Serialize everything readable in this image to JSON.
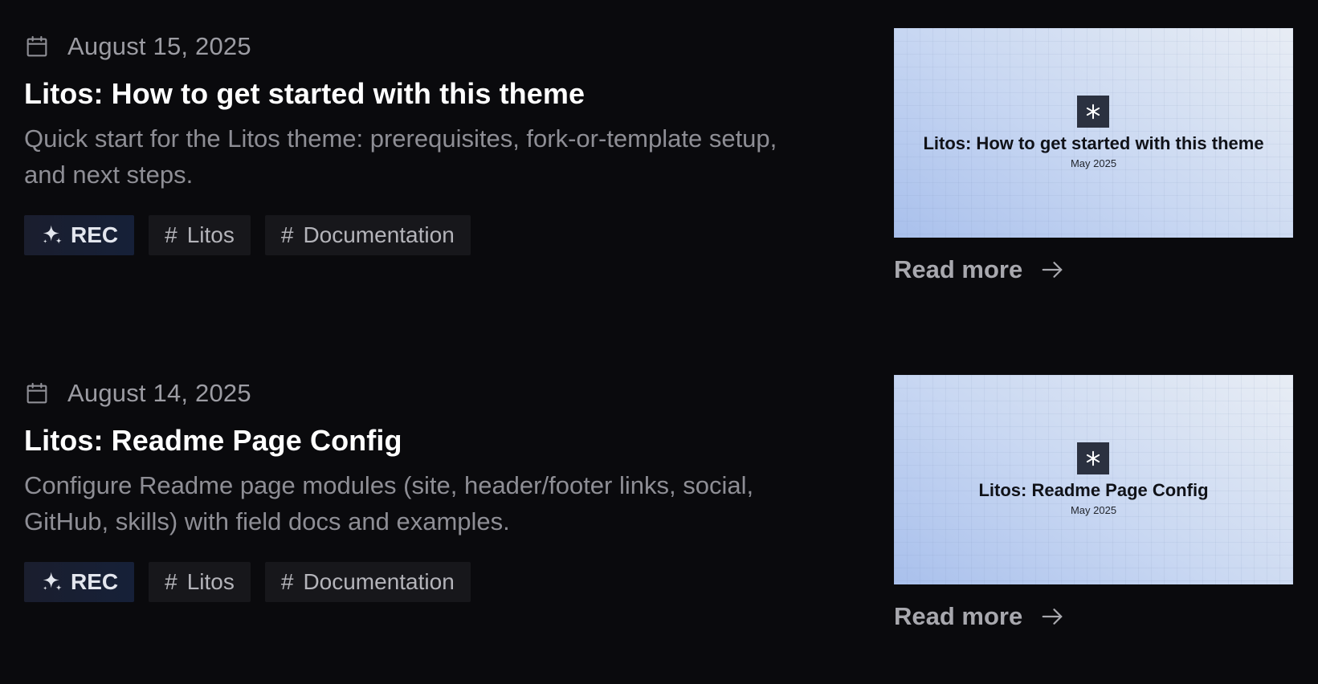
{
  "colors": {
    "background": "#0a0a0d",
    "title": "#ffffff",
    "muted_text": "#8e8e95",
    "tag_background": "#17171b",
    "rec_tag_background": "#162038",
    "thumbnail_gradient_start": "#a9c0ec",
    "thumbnail_gradient_end": "#e8edf4"
  },
  "posts": [
    {
      "date_icon": "calendar-icon",
      "date": "August 15, 2025",
      "title": "Litos: How to get started with this theme",
      "description": "Quick start for the Litos theme: prerequisites, fork-or-template setup, and next steps.",
      "tags": [
        {
          "icon": "sparkle-icon",
          "label": "REC"
        },
        {
          "icon": "hash-icon",
          "label": "Litos"
        },
        {
          "icon": "hash-icon",
          "label": "Documentation"
        }
      ],
      "thumbnail": {
        "logo_icon": "asterisk-logo-icon",
        "title": "Litos: How to get started with this theme",
        "date": "May 2025"
      },
      "read_more": "Read more",
      "read_more_icon": "arrow-right-icon"
    },
    {
      "date_icon": "calendar-icon",
      "date": "August 14, 2025",
      "title": "Litos: Readme Page Config",
      "description": "Configure Readme page modules (site, header/footer links, social, GitHub, skills) with field docs and examples.",
      "tags": [
        {
          "icon": "sparkle-icon",
          "label": "REC"
        },
        {
          "icon": "hash-icon",
          "label": "Litos"
        },
        {
          "icon": "hash-icon",
          "label": "Documentation"
        }
      ],
      "thumbnail": {
        "logo_icon": "asterisk-logo-icon",
        "title": "Litos: Readme Page Config",
        "date": "May 2025"
      },
      "read_more": "Read more",
      "read_more_icon": "arrow-right-icon"
    }
  ]
}
